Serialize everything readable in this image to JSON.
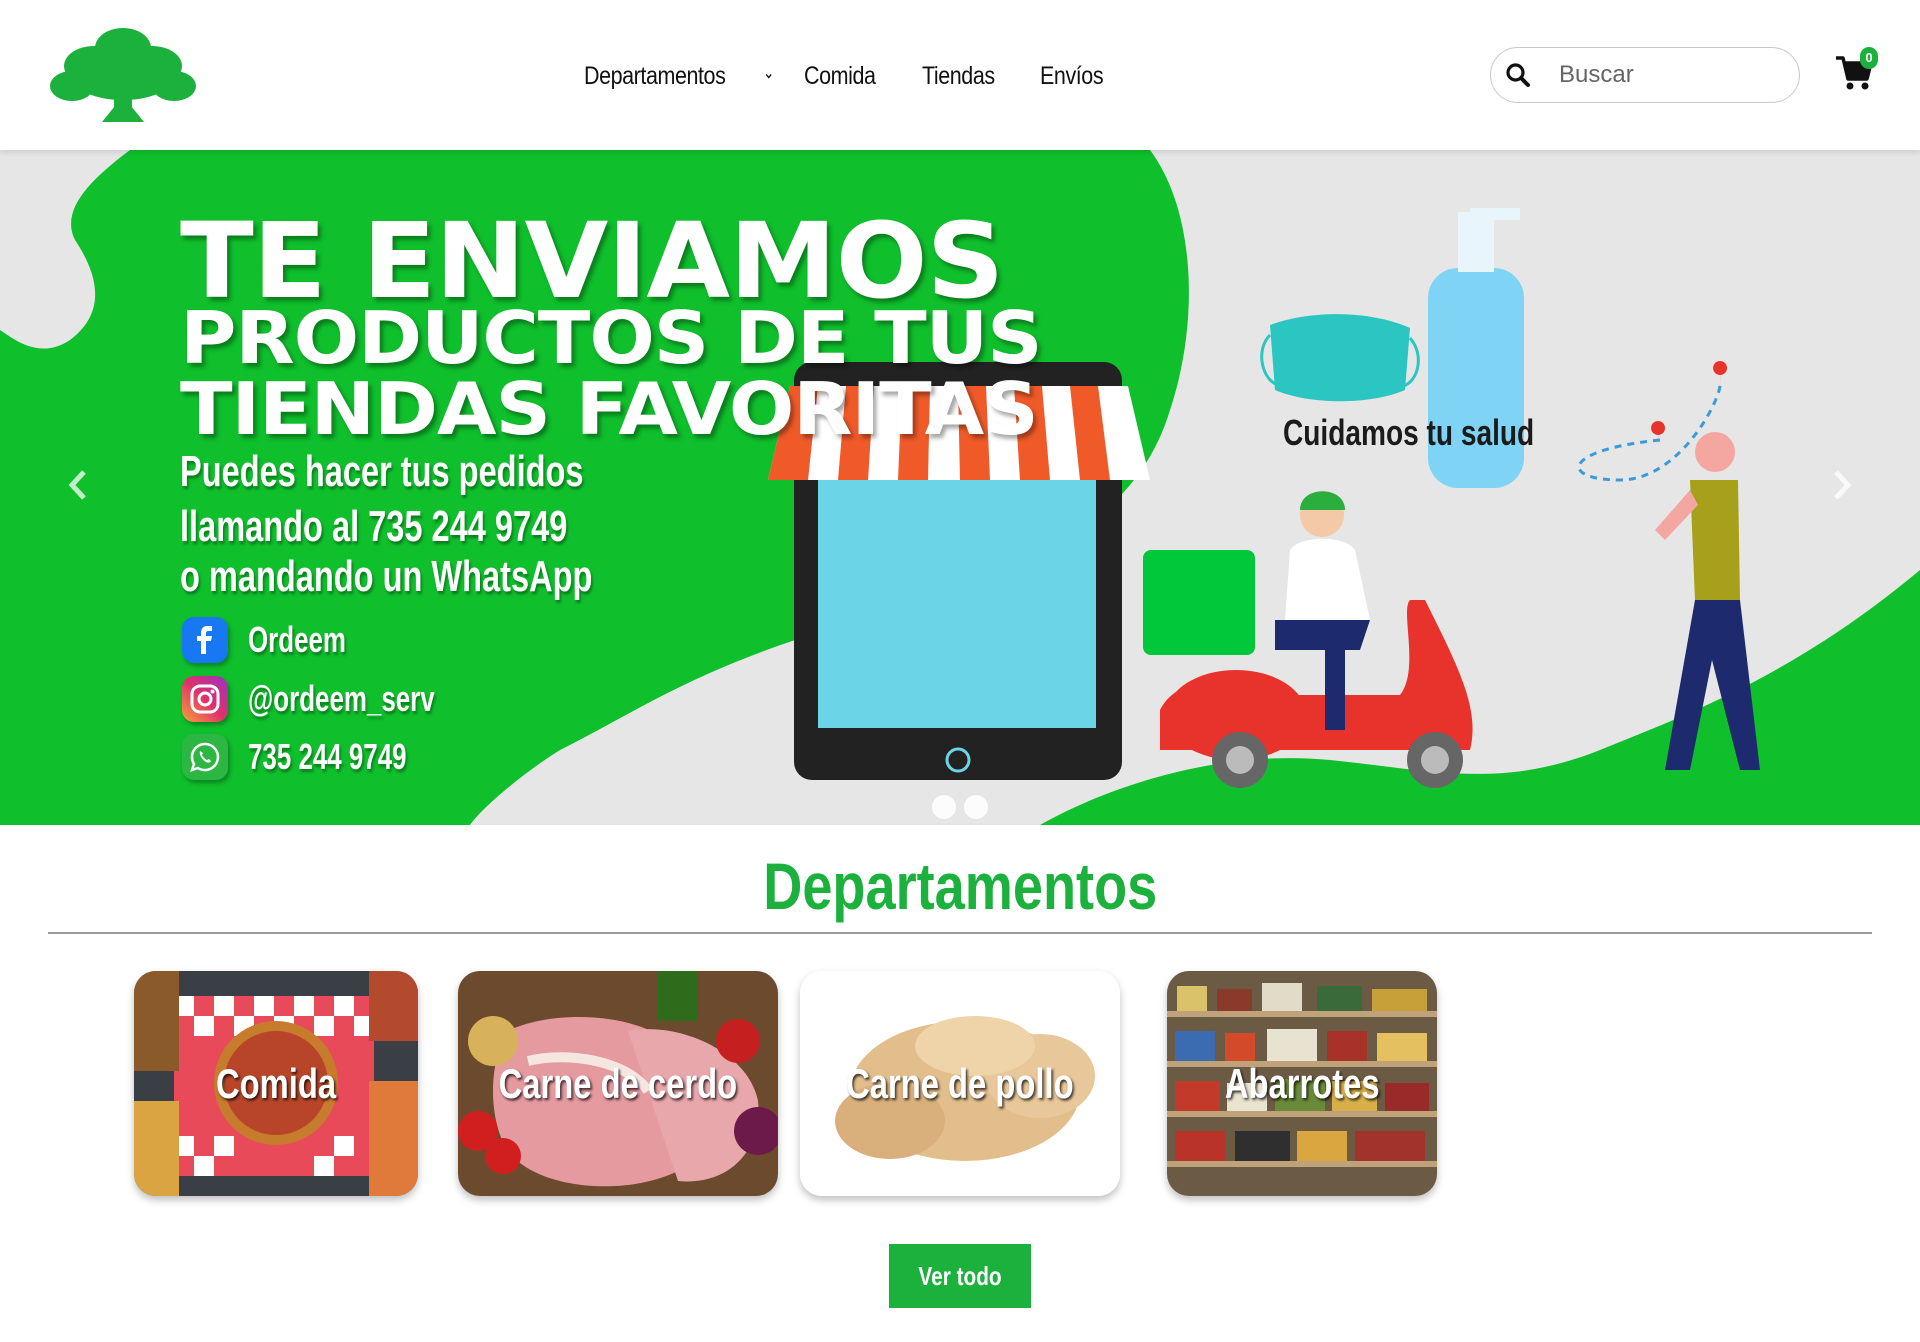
{
  "header": {
    "logo_icon": "tree-logo",
    "nav": [
      {
        "label": "Departamentos",
        "has_dropdown": true
      },
      {
        "label": "Comida"
      },
      {
        "label": "Tiendas"
      },
      {
        "label": "Envíos"
      }
    ],
    "search": {
      "placeholder": "Buscar",
      "icon": "search-icon"
    },
    "cart": {
      "icon": "cart-icon",
      "count": "0"
    }
  },
  "hero": {
    "slides_total": 2,
    "active_slide": 1,
    "title_line1": "TE ENVIAMOS",
    "title_line2": "PRODUCTOS DE TUS",
    "title_line3": "TIENDAS FAVORITAS",
    "sub_line1": "Puedes hacer tus pedidos",
    "sub_line2": "llamando al 735 244 9749",
    "sub_line3": "o mandando un WhatsApp",
    "social": [
      {
        "icon": "facebook-icon",
        "text": "Ordeem"
      },
      {
        "icon": "instagram-icon",
        "text": "@ordeem_serv"
      },
      {
        "icon": "whatsapp-icon",
        "text": "735 244 9749"
      }
    ],
    "health_caption": "Cuidamos tu salud",
    "prev_icon": "chevron-left-icon",
    "next_icon": "chevron-right-icon"
  },
  "departments": {
    "title": "Departamentos",
    "items": [
      {
        "label": "Comida"
      },
      {
        "label": "Carne de cerdo"
      },
      {
        "label": "Carne de pollo"
      },
      {
        "label": "Abarrotes"
      }
    ],
    "view_all_label": "Ver todo"
  },
  "colors": {
    "brand_green": "#1bb13c",
    "hero_green": "#0fbf2c",
    "hero_gray": "#e6e6e6"
  }
}
